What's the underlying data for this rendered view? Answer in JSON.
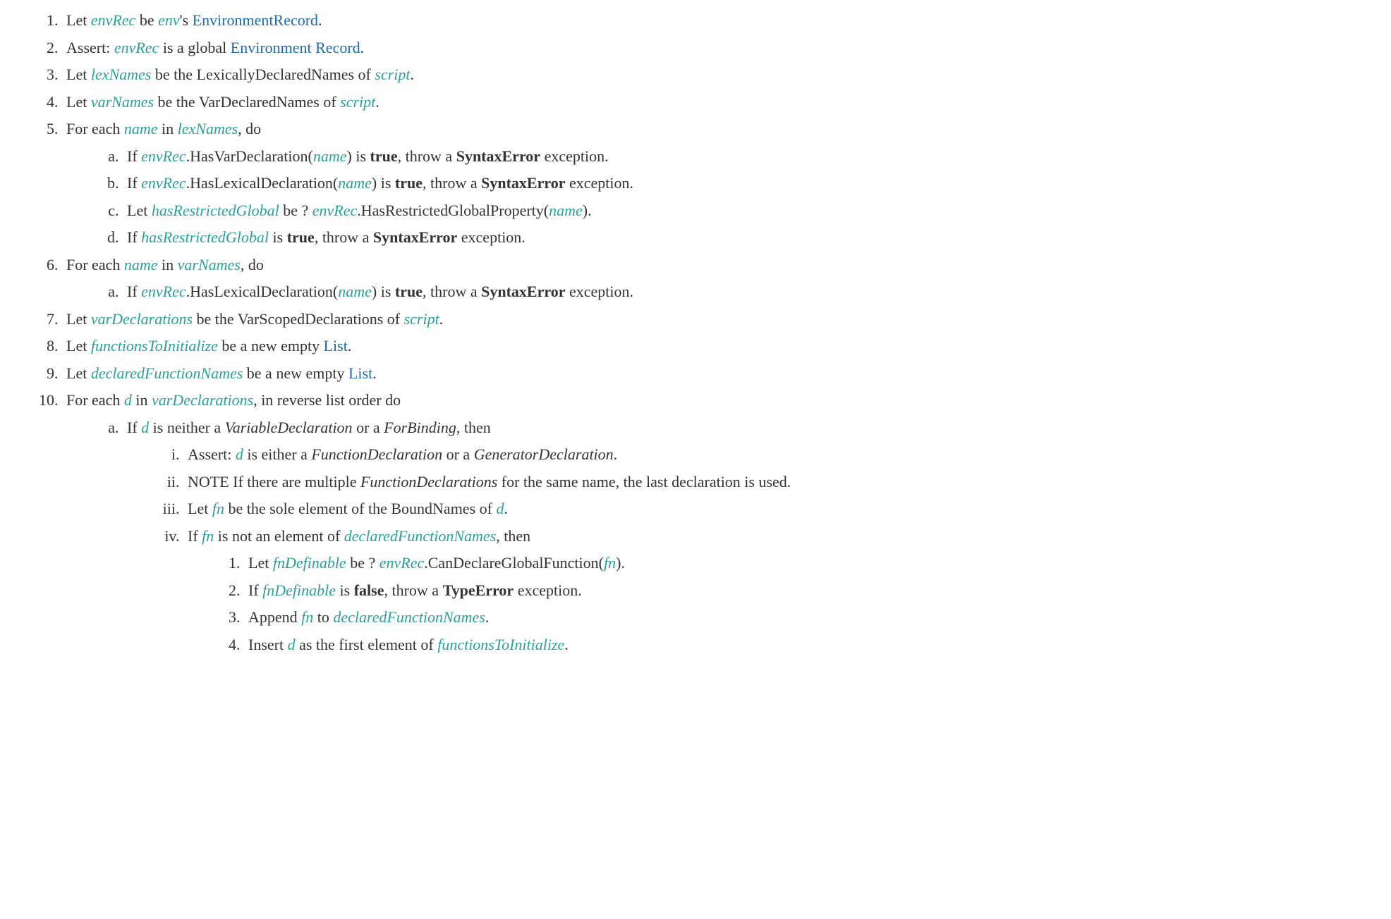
{
  "t": {
    "let": "Let ",
    "be": " be ",
    "bes": "'s ",
    "assert": "Assert: ",
    "isglobal_a": " is a global ",
    "bethe": " be the ",
    "lexicallyDeclaredNames": "LexicallyDeclaredNames of ",
    "varDeclaredNames": "VarDeclaredNames of ",
    "foreach": "For each ",
    "in": " in ",
    "do": ", do",
    "if": "If ",
    "hasVarDecl_a": ".HasVarDeclaration(",
    "hasLexDecl_a": ".HasLexicalDeclaration(",
    "close_is": ") is ",
    "true": "true",
    "false": "false",
    "throw_a": ", throw a ",
    "syntaxError": "SyntaxError",
    "typeError": "TypeError",
    "exception": " exception.",
    "beQ": " be ? ",
    "hasRestricted_a": ".HasRestrictedGlobalProperty(",
    "close_paren_dot": ").",
    "is": " is ",
    "varScoped": " be the VarScopedDeclarations of ",
    "newEmpty": " be a new empty ",
    "period": ".",
    "revorder": ", in reverse list order do",
    "neither_a": " is neither a ",
    "ora": " or a ",
    "then": ", then",
    "either_a": " is either a ",
    "generatorDecl": "GeneratorDeclaration",
    "note_multi_a": "NOTE If there are multiple ",
    "funcDecls": "FunctionDeclarations",
    "note_multi_b": " for the same name, the last declaration is used.",
    "sole_a": " be the sole element of the BoundNames of ",
    "notelem_a": " is not an element of ",
    "canDecl_a": ".CanDeclareGlobalFunction(",
    "append": "Append ",
    "to": " to ",
    "insert": "Insert ",
    "asfirst": " as the first element of "
  },
  "v": {
    "envRec": "envRec",
    "env": "env",
    "lexNames": "lexNames",
    "script": "script",
    "varNames": "varNames",
    "name": "name",
    "hasRestrictedGlobal": "hasRestrictedGlobal",
    "varDeclarations": "varDeclarations",
    "functionsToInitialize": "functionsToInitialize",
    "declaredFunctionNames": "declaredFunctionNames",
    "d": "d",
    "fn": "fn",
    "fnDefinable": "fnDefinable"
  },
  "l": {
    "EnvironmentRecord": "EnvironmentRecord",
    "EnvironmentRecord2": "Environment Record",
    "List": "List"
  },
  "nt": {
    "VariableDeclaration": "VariableDeclaration",
    "ForBinding": "ForBinding",
    "FunctionDeclaration": "FunctionDeclaration"
  }
}
